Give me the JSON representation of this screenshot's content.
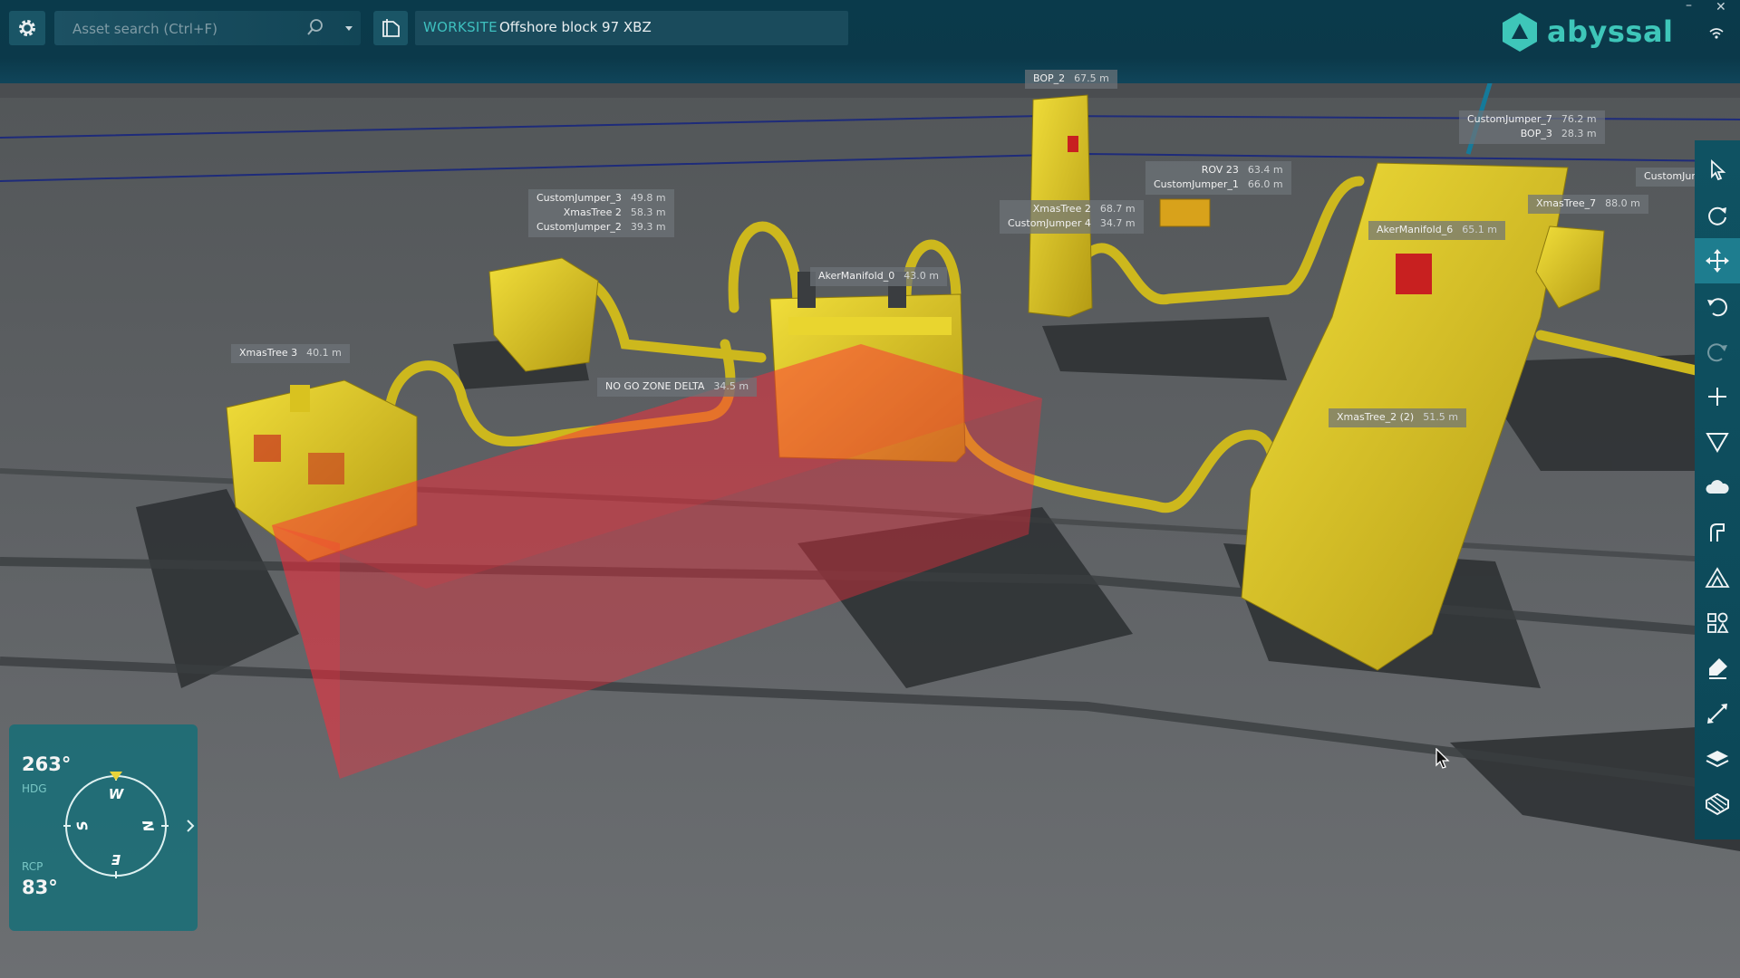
{
  "topbar": {
    "search_placeholder": "Asset search (Ctrl+F)",
    "worksite_label": "WORKSITE",
    "worksite_value": "Offshore block 97 XBZ",
    "logo_text": "abyssal",
    "minimize": "–",
    "close": "✕"
  },
  "labels": {
    "bop2": [
      {
        "name": "BOP_2",
        "dist": "67.5 m"
      }
    ],
    "cj7": [
      {
        "name": "CustomJumper_7",
        "dist": "76.2 m"
      },
      {
        "name": "BOP_3",
        "dist": "28.3 m"
      }
    ],
    "rov": [
      {
        "name": "ROV 23",
        "dist": "63.4 m"
      },
      {
        "name": "CustomJumper_1",
        "dist": "66.0 m"
      }
    ],
    "cjcut": [
      {
        "name": "CustomJum",
        "dist": ""
      }
    ],
    "cj3": [
      {
        "name": "CustomJumper_3",
        "dist": "49.8 m"
      },
      {
        "name": "XmasTree 2",
        "dist": "58.3 m"
      },
      {
        "name": "CustomJumper_2",
        "dist": "39.3 m"
      }
    ],
    "xt2": [
      {
        "name": "XmasTree 2",
        "dist": "68.7 m"
      },
      {
        "name": "CustomJumper 4",
        "dist": "34.7 m"
      }
    ],
    "xt7": [
      {
        "name": "XmasTree_7",
        "dist": "88.0 m"
      }
    ],
    "aker6": [
      {
        "name": "AkerManifold_6",
        "dist": "65.1 m"
      }
    ],
    "aker0": [
      {
        "name": "AkerManifold_0",
        "dist": "43.0 m"
      }
    ],
    "xt3": [
      {
        "name": "XmasTree 3",
        "dist": "40.1 m"
      }
    ],
    "nogo": [
      {
        "name": "NO GO ZONE DELTA",
        "dist": "34.5 m"
      }
    ],
    "xt2b": [
      {
        "name": "XmasTree_2 (2)",
        "dist": "51.5 m"
      }
    ]
  },
  "compass": {
    "heading": "263°",
    "heading_label": "HDG",
    "rcp_label": "RCP",
    "rcp": "83°",
    "dir_w": "W",
    "dir_n": "N",
    "dir_e": "E",
    "dir_s": "S"
  },
  "colors": {
    "equipment": "#d9c21f",
    "nogo": "#ff3040",
    "accent": "#3ec6b9",
    "toolbar": "#0f5262"
  },
  "toolbar_icons": [
    "select-arrow-icon",
    "rotate-view-icon",
    "move-icon",
    "undo-icon",
    "redo-icon",
    "add-icon",
    "funnel-icon",
    "cloud-icon",
    "path-icon",
    "terrain-icon",
    "shapes-icon",
    "eraser-icon",
    "measure-icon",
    "layers-icon",
    "layers-hatched-icon"
  ]
}
